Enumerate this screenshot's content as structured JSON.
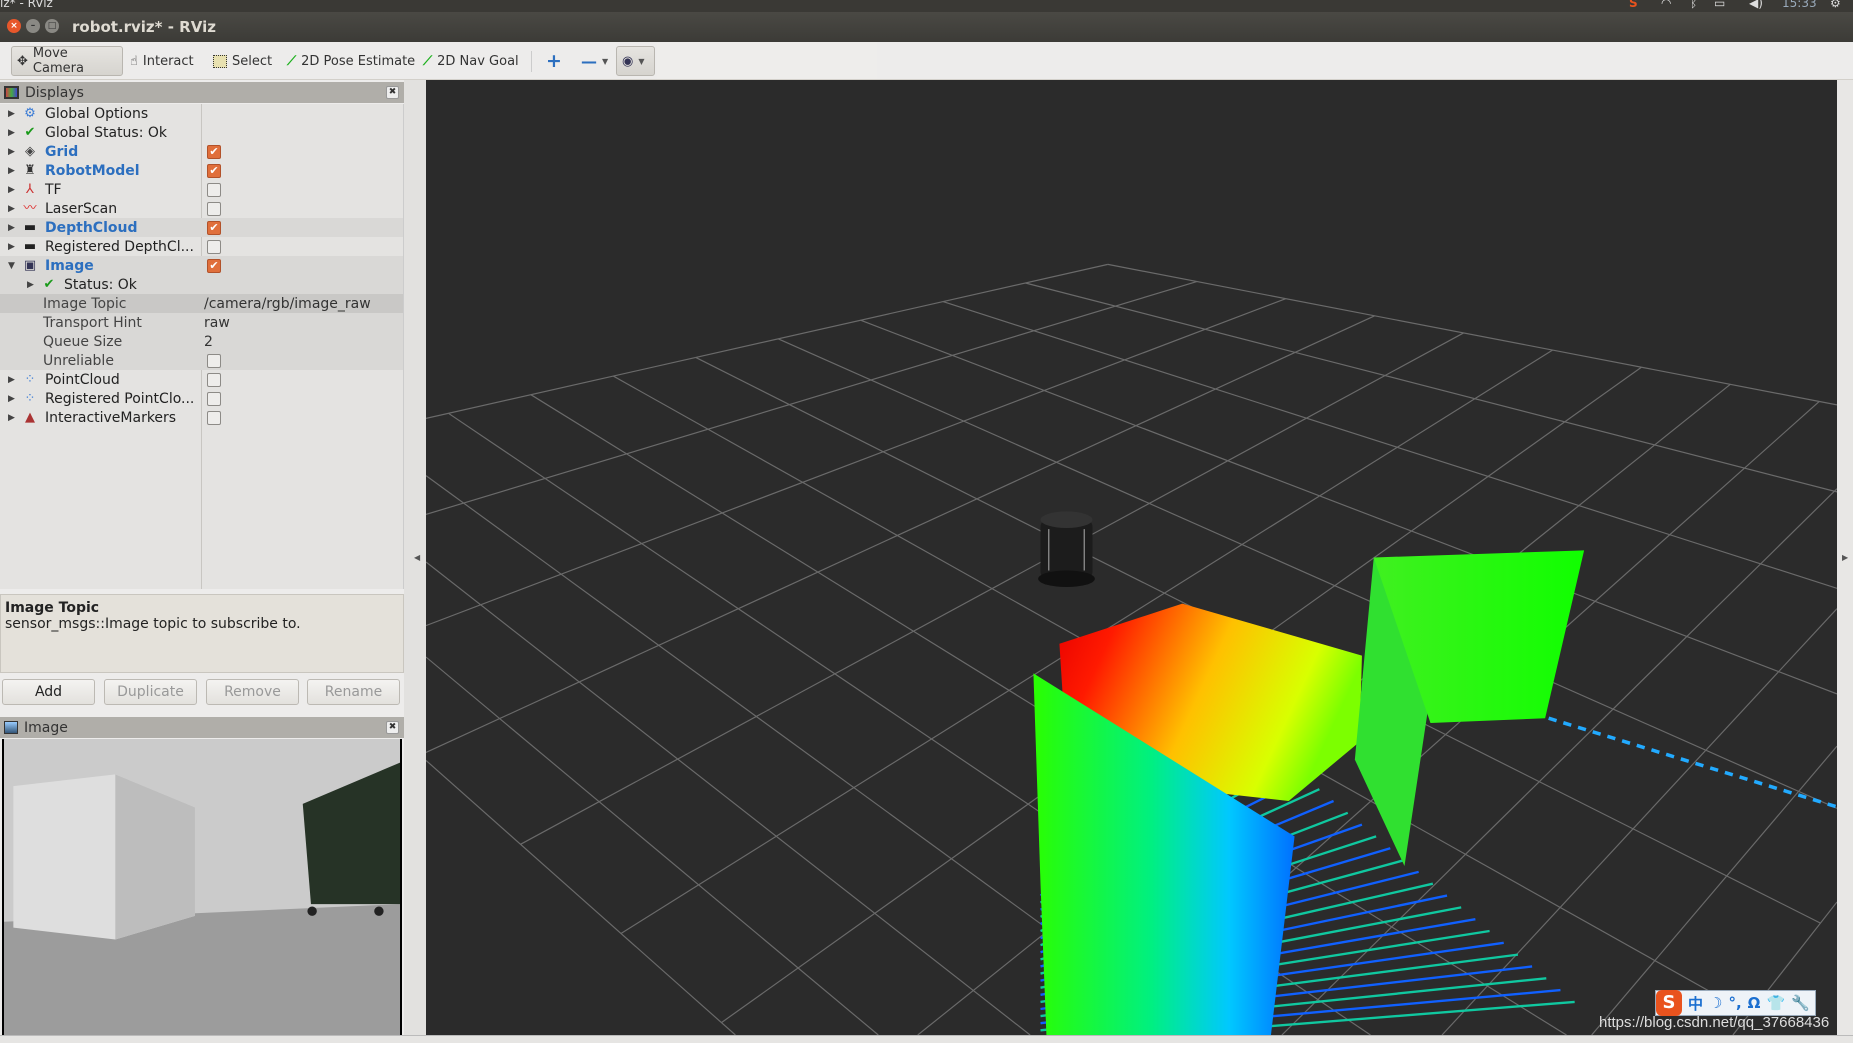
{
  "os_bar": {
    "window_title_fragment": "iz* - RViz",
    "clock": "15:33",
    "icons": [
      "sogou-icon",
      "wifi-icon",
      "bluetooth-icon",
      "battery-icon",
      "volume-icon",
      "gear-icon"
    ]
  },
  "window": {
    "title": "robot.rviz* - RViz"
  },
  "toolbar": {
    "tools": [
      {
        "label": "Move Camera",
        "icon": "move-camera-icon",
        "active": true
      },
      {
        "label": "Interact",
        "icon": "hand-icon"
      },
      {
        "label": "Select",
        "icon": "select-icon"
      },
      {
        "label": "2D Pose Estimate",
        "icon": "green-arrow-icon"
      },
      {
        "label": "2D Nav Goal",
        "icon": "green-arrow-icon"
      }
    ],
    "extra_icons": [
      "plus-icon",
      "minus-icon",
      "eye-icon"
    ]
  },
  "displays": {
    "title": "Displays",
    "items": [
      {
        "label": "Global Options",
        "icon": "gear-icon",
        "expanded": false
      },
      {
        "label": "Global Status: Ok",
        "icon": "check-icon"
      },
      {
        "label": "Grid",
        "icon": "grid-icon",
        "checked": true,
        "highlight": true
      },
      {
        "label": "RobotModel",
        "icon": "robot-icon",
        "checked": true,
        "highlight": true
      },
      {
        "label": "TF",
        "icon": "axes-icon",
        "checked": false
      },
      {
        "label": "LaserScan",
        "icon": "laser-icon",
        "checked": false
      },
      {
        "label": "DepthCloud",
        "icon": "kinect-icon",
        "checked": true,
        "highlight": true
      },
      {
        "label": "Registered DepthCl...",
        "icon": "kinect-icon",
        "checked": false
      },
      {
        "label": "Image",
        "icon": "image-icon",
        "checked": true,
        "highlight": true,
        "expanded": true
      },
      {
        "label": "Status: Ok",
        "icon": "check-icon",
        "child": true
      },
      {
        "label": "Image Topic",
        "value": "/camera/rgb/image_raw",
        "property": true,
        "selected": true
      },
      {
        "label": "Transport Hint",
        "value": "raw",
        "property": true
      },
      {
        "label": "Queue Size",
        "value": "2",
        "property": true
      },
      {
        "label": "Unreliable",
        "property": true,
        "checked": false
      },
      {
        "label": "PointCloud",
        "icon": "pointcloud-icon",
        "checked": false
      },
      {
        "label": "Registered PointClo...",
        "icon": "pointcloud-icon",
        "checked": false
      },
      {
        "label": "InteractiveMarkers",
        "icon": "markers-icon",
        "checked": false
      }
    ]
  },
  "description": {
    "title": "Image Topic",
    "text": "sensor_msgs::Image topic to subscribe to."
  },
  "buttons": {
    "add": "Add",
    "duplicate": "Duplicate",
    "remove": "Remove",
    "rename": "Rename"
  },
  "image_panel": {
    "title": "Image"
  },
  "ime": {
    "items": [
      "中",
      "☽",
      "°,",
      "Ω",
      "👕",
      "🔧"
    ]
  },
  "watermark": "https://blog.csdn.net/qq_37668436",
  "colors": {
    "accent": "#e06f3b",
    "link_blue": "#2c6fbf",
    "viewport_bg": "#2b2b2b"
  }
}
